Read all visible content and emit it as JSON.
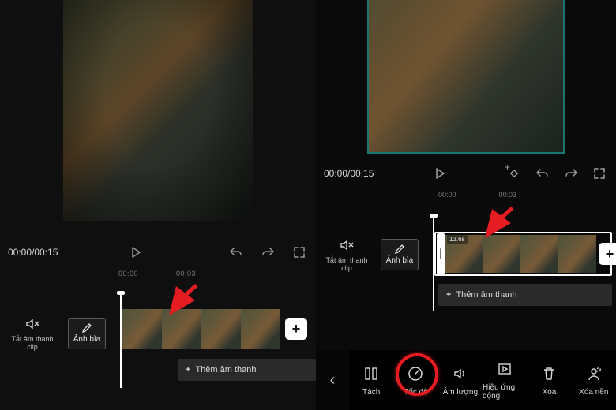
{
  "left": {
    "time": "00:00/00:15",
    "ruler": [
      "00:00",
      "00:03"
    ],
    "mute_label": "Tắt âm thanh clip",
    "cover_label": "Ảnh bìa",
    "add_audio": "Thêm âm thanh"
  },
  "right": {
    "time": "00:00/00:15",
    "ruler": [
      "00:00",
      "00:03"
    ],
    "mute_label": "Tắt âm thanh clip",
    "cover_label": "Ảnh bìa",
    "clip_duration": "13.6s",
    "add_audio": "Thêm âm thanh"
  },
  "toolbar": {
    "items": [
      {
        "key": "split",
        "label": "Tách"
      },
      {
        "key": "speed",
        "label": "Tốc độ"
      },
      {
        "key": "volume",
        "label": "Âm lượng"
      },
      {
        "key": "effects",
        "label": "Hiệu ứng động"
      },
      {
        "key": "delete",
        "label": "Xóa"
      },
      {
        "key": "removebg",
        "label": "Xóa nền"
      }
    ]
  },
  "icons": {
    "play": "play",
    "undo": "undo",
    "redo": "redo",
    "fullscreen": "fullscreen",
    "keyframe": "keyframe",
    "mute": "mute",
    "pencil": "pencil",
    "plus": "+",
    "chevron": "‹",
    "split": "split",
    "speed": "speed",
    "volume": "volume",
    "effects": "effects",
    "trash": "trash",
    "person": "person"
  }
}
